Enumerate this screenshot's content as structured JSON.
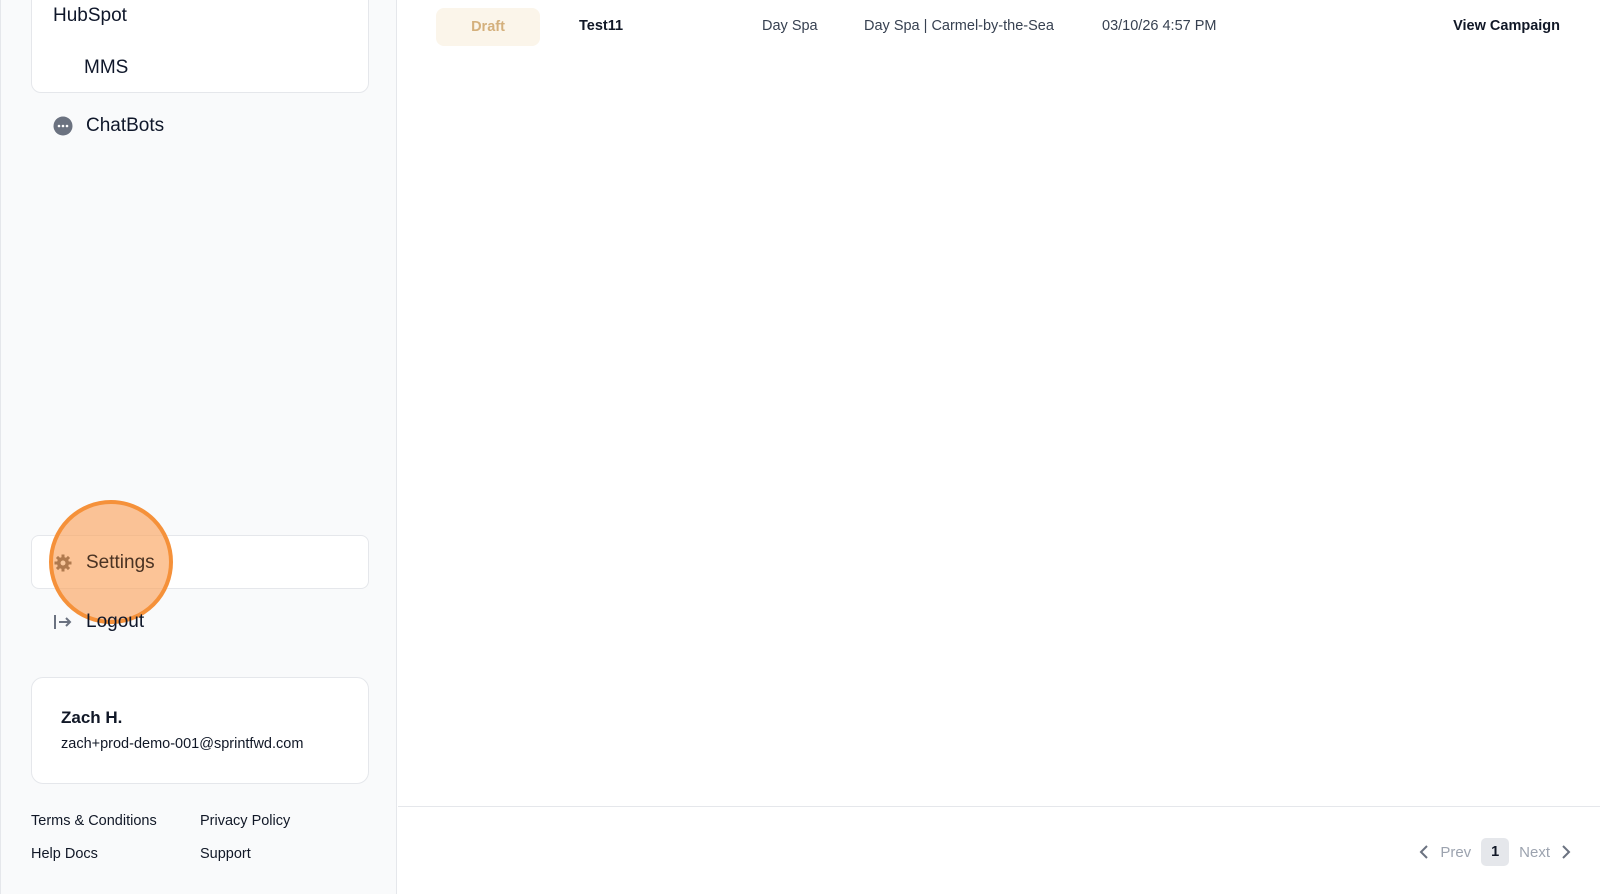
{
  "sidebar": {
    "submenu": [
      "HubSpot",
      "MMS"
    ],
    "chatbots_label": "ChatBots",
    "settings_label": "Settings",
    "logout_label": "Logout",
    "user": {
      "name": "Zach H.",
      "email": "zach+prod-demo-001@sprintfwd.com"
    },
    "footer": {
      "terms": "Terms & Conditions",
      "privacy": "Privacy Policy",
      "help": "Help Docs",
      "support": "Support"
    }
  },
  "campaigns": {
    "rows": [
      {
        "status": "Draft",
        "name": "Test11",
        "category": "Day Spa",
        "location": "Day Spa | Carmel-by-the-Sea",
        "date": "03/10/26 4:57 PM",
        "action": "View Campaign"
      }
    ]
  },
  "pagination": {
    "prev": "Prev",
    "page": "1",
    "next": "Next"
  },
  "colors": {
    "draft_bg": "#fbf5ea",
    "draft_text": "#d4b07c",
    "click_highlight": "#f5913a"
  },
  "icons": {
    "chatbots": "chat-bubble-icon",
    "settings": "gear-icon",
    "logout": "logout-arrow-icon",
    "prev": "chevron-left-icon",
    "next": "chevron-right-icon"
  }
}
